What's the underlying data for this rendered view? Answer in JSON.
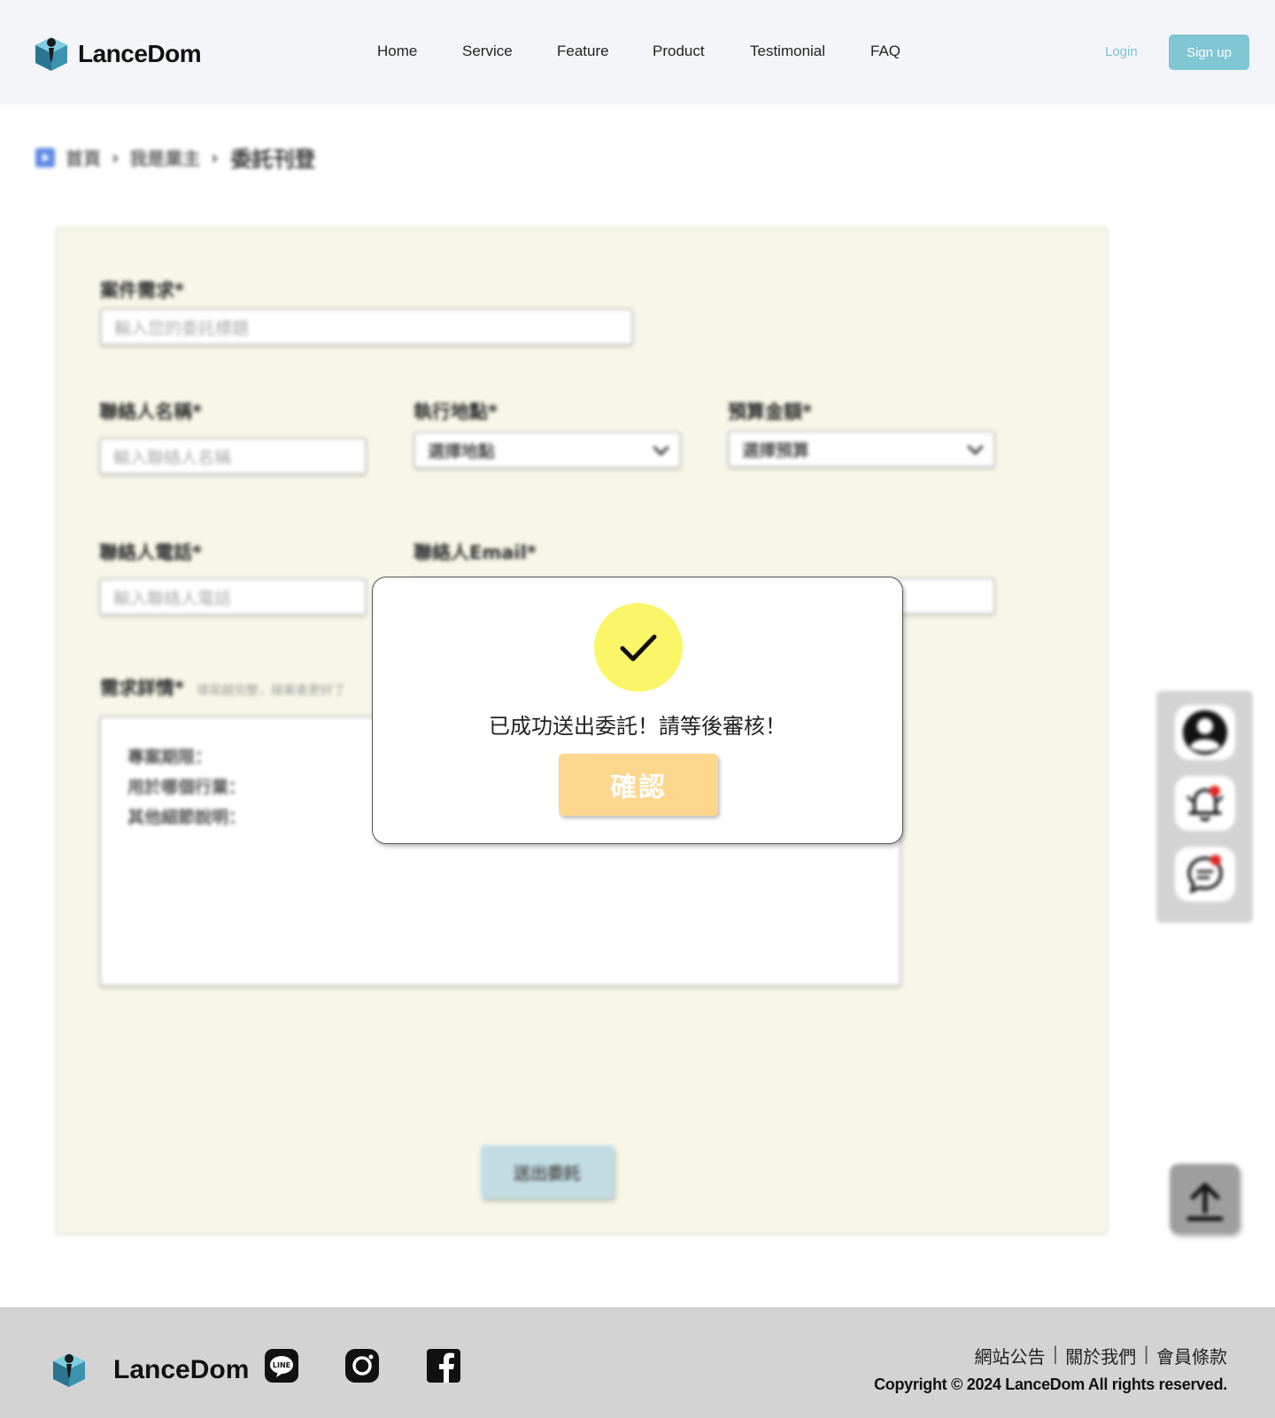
{
  "header": {
    "brand": "LanceDom",
    "nav": [
      "Home",
      "Service",
      "Feature",
      "Product",
      "Testimonial",
      "FAQ"
    ],
    "login": "Login",
    "signup": "Sign up"
  },
  "breadcrumb": {
    "items": [
      "首頁",
      "我是業主"
    ],
    "current": "委託刊登"
  },
  "form": {
    "case_label": "案件需求*",
    "case_placeholder": "輸入您的委託標題",
    "contact_name_label": "聯絡人名稱*",
    "contact_name_placeholder": "輸入聯絡人名稱",
    "location_label": "執行地點*",
    "location_value": "選擇地點",
    "budget_label": "預算金額*",
    "budget_value": "選擇預算",
    "phone_label": "聯絡人電話*",
    "phone_placeholder": "輸入聯絡人電話",
    "email_label": "聯絡人Email*",
    "detail_label": "需求詳情*",
    "detail_hint": "填寫越完整，接案者更好了",
    "detail_lines": [
      "專案期限：",
      "用於哪個行業：",
      "其他細節說明："
    ],
    "submit": "送出委託"
  },
  "side_panel": {
    "icons": [
      "user-icon",
      "notification-bell-icon",
      "chat-icon"
    ],
    "badge_color": "#e52222"
  },
  "back_to_top_icon": "arrow-up-icon",
  "modal": {
    "icon": "check-icon",
    "message": "已成功送出委託！請等後審核！",
    "confirm": "確認"
  },
  "footer": {
    "brand": "LanceDom",
    "social": [
      "line-icon",
      "instagram-icon",
      "facebook-icon"
    ],
    "links": [
      "網站公告",
      "關於我們",
      "會員條款"
    ],
    "copyright": "Copyright © 2024 LanceDom All rights reserved."
  },
  "colors": {
    "accent": "#80c6d3",
    "form_bg": "#f6f7e8",
    "confirm": "#fed78f",
    "check_bg": "#fbf667"
  }
}
